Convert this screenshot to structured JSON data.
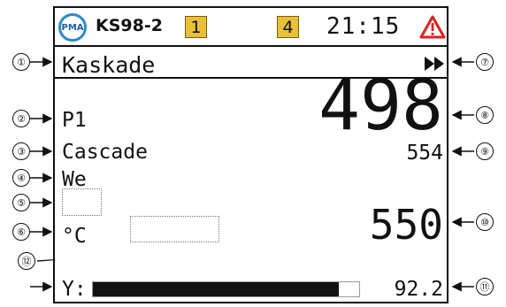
{
  "header": {
    "logo_text": "PMA",
    "model": "KS98-2",
    "badge_1": "1",
    "badge_2": "4",
    "time": "21:15",
    "warning_icon": "warning-triangle-icon",
    "badge_color": "#e8c03a",
    "logo_color": "#2a8ac8",
    "warning_color": "#e02020"
  },
  "mode_line": {
    "label": "Kaskade",
    "right_icon": "fast-forward-icon"
  },
  "left_column": {
    "loop": "P1",
    "name": "Cascade",
    "setpoint_type": "We",
    "unit": "°C"
  },
  "values": {
    "process_value": "498",
    "secondary_value": "554",
    "setpoint_value": "550",
    "output_value": "92.2"
  },
  "output": {
    "label": "Y:",
    "level_percent": 92.2
  },
  "callouts": [
    "①",
    "②",
    "③",
    "④",
    "⑤",
    "⑥",
    "⑦",
    "⑧",
    "⑨",
    "⑩",
    "⑪",
    "⑫"
  ]
}
